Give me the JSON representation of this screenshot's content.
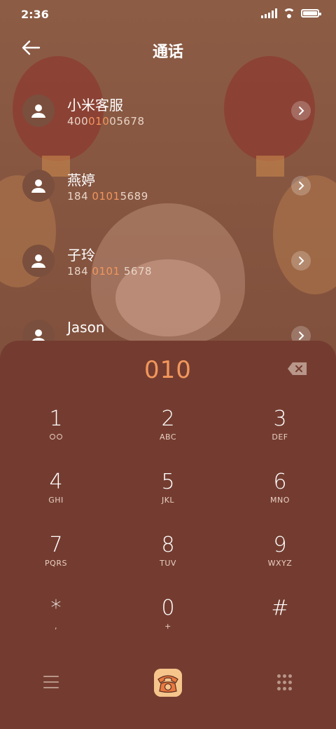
{
  "status": {
    "time": "2:36"
  },
  "header": {
    "title": "通话",
    "back_icon": "arrow-left-icon"
  },
  "contacts": [
    {
      "name": "小米客服",
      "number_pre": "400",
      "number_hl": "010",
      "number_post": "05678"
    },
    {
      "name": "燕婷",
      "number_pre": "184 ",
      "number_hl": "0101",
      "number_post": "5689"
    },
    {
      "name": "子玲",
      "number_pre": "184 ",
      "number_hl": "0101",
      "number_post": " 5678"
    },
    {
      "name": "Jason",
      "number_pre": "",
      "number_hl": "",
      "number_post": ""
    }
  ],
  "dialer": {
    "input": "010",
    "keys": [
      {
        "digit": "1",
        "letters": ""
      },
      {
        "digit": "2",
        "letters": "ABC"
      },
      {
        "digit": "3",
        "letters": "DEF"
      },
      {
        "digit": "4",
        "letters": "GHI"
      },
      {
        "digit": "5",
        "letters": "JKL"
      },
      {
        "digit": "6",
        "letters": "MNO"
      },
      {
        "digit": "7",
        "letters": "PQRS"
      },
      {
        "digit": "8",
        "letters": "TUV"
      },
      {
        "digit": "9",
        "letters": "WXYZ"
      },
      {
        "digit": "*",
        "letters": ","
      },
      {
        "digit": "0",
        "letters": "+"
      },
      {
        "digit": "#",
        "letters": ""
      }
    ]
  },
  "colors": {
    "accent": "#f2975c",
    "panel": "#743c30",
    "highlight": "#f1965d"
  },
  "icons": {
    "delete": "backspace-icon",
    "menu": "menu-icon",
    "call": "telephone-icon",
    "keypad": "dialpad-icon",
    "chevron": "chevron-right-icon",
    "avatar": "person-icon",
    "voicemail": "voicemail-icon"
  }
}
